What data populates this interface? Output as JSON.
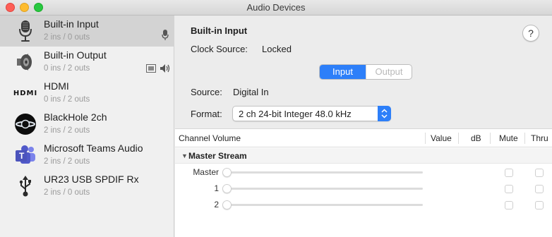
{
  "window": {
    "title": "Audio Devices"
  },
  "sidebar": {
    "devices": [
      {
        "name": "Built-in Input",
        "io": "2 ins / 0 outs",
        "icon": "microphone-icon",
        "selected": true,
        "indicators": [
          "mic-indicator-icon"
        ]
      },
      {
        "name": "Built-in Output",
        "io": "0 ins / 2 outs",
        "icon": "speaker-icon",
        "selected": false,
        "indicators": [
          "screen-indicator-icon",
          "speaker-indicator-icon"
        ]
      },
      {
        "name": "HDMI",
        "io": "0 ins / 2 outs",
        "icon": "hdmi-icon",
        "icon_text": "HDMI",
        "selected": false
      },
      {
        "name": "BlackHole 2ch",
        "io": "2 ins / 2 outs",
        "icon": "blackhole-icon",
        "selected": false
      },
      {
        "name": "Microsoft Teams Audio",
        "io": "2 ins / 2 outs",
        "icon": "teams-icon",
        "icon_text": "T",
        "selected": false
      },
      {
        "name": "UR23 USB SPDIF Rx",
        "io": "2 ins / 0 outs",
        "icon": "usb-icon",
        "selected": false
      }
    ]
  },
  "main": {
    "device_title": "Built-in Input",
    "clock_source_label": "Clock Source:",
    "clock_source_value": "Locked",
    "help": "?",
    "segment": {
      "input": "Input",
      "output": "Output",
      "selected": "Input"
    },
    "source_label": "Source:",
    "source_value": "Digital In",
    "format_label": "Format:",
    "format_value": "2 ch 24-bit Integer 48.0 kHz"
  },
  "channel_table": {
    "headers": [
      "Channel Volume",
      "Value",
      "dB",
      "Mute",
      "Thru"
    ],
    "group": "Master Stream",
    "rows": [
      {
        "label": "Master",
        "mute": false,
        "thru": false
      },
      {
        "label": "1",
        "mute": false,
        "thru": false
      },
      {
        "label": "2",
        "mute": false,
        "thru": false
      }
    ]
  },
  "colors": {
    "accent": "#2d7ff9",
    "selection": "#d3d3d3"
  }
}
